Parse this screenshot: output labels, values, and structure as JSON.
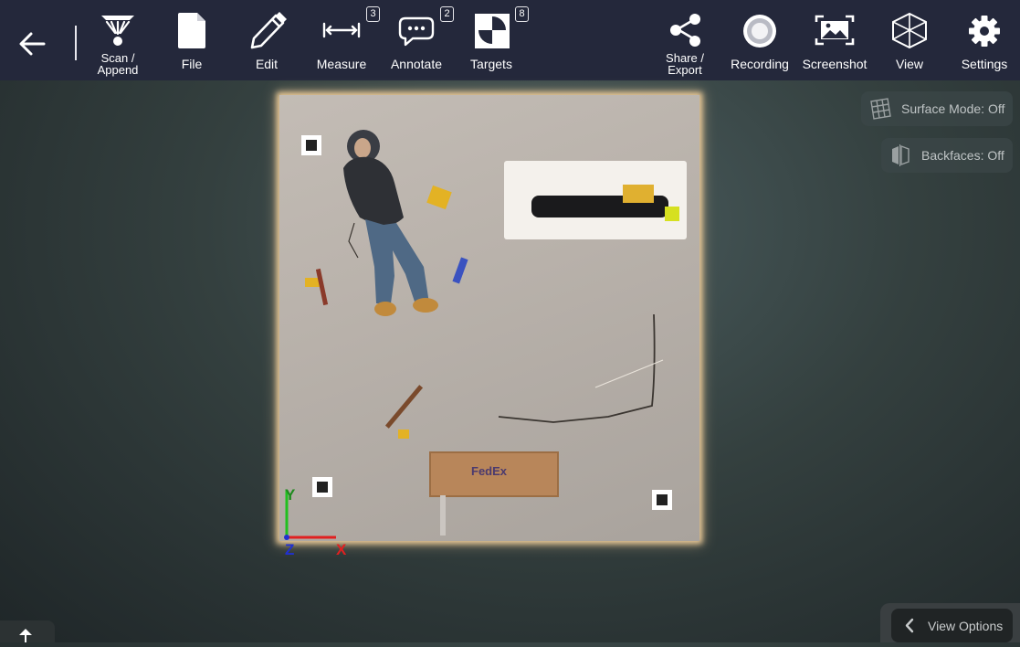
{
  "toolbar": {
    "back_label": "",
    "scan_append": "Scan /\nAppend",
    "file": "File",
    "edit": "Edit",
    "measure": "Measure",
    "measure_count": "3",
    "annotate": "Annotate",
    "annotate_count": "2",
    "targets": "Targets",
    "targets_count": "8",
    "share_export": "Share /\nExport",
    "recording": "Recording",
    "screenshot": "Screenshot",
    "view": "View",
    "settings": "Settings"
  },
  "side_panel": {
    "surface_mode": "Surface Mode: Off",
    "backfaces": "Backfaces: Off"
  },
  "scene": {
    "box_label": "FedEx",
    "axis_y": "Y",
    "axis_z": "Z",
    "axis_x": "X"
  },
  "bottom": {
    "view_options": "View Options"
  },
  "colors": {
    "toolbar_bg": "#24283b",
    "axis_x": "#e02020",
    "axis_y": "#20c020",
    "axis_z": "#2030d0"
  }
}
